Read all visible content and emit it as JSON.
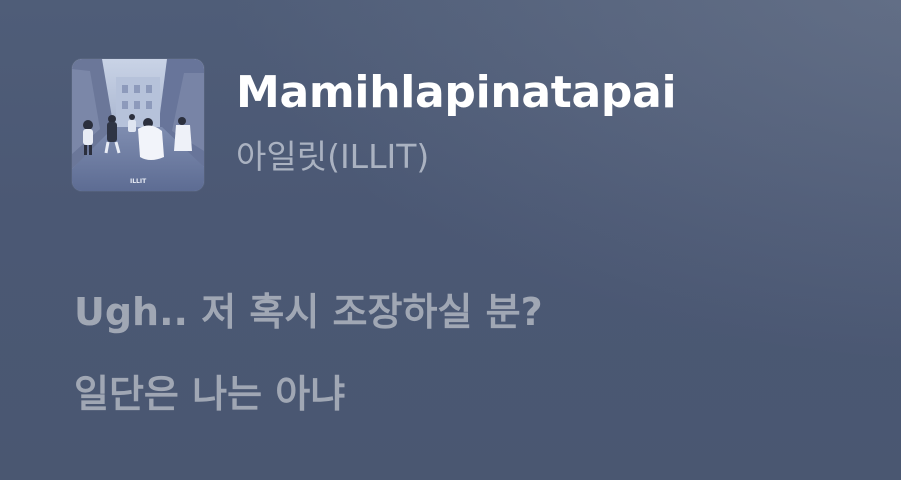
{
  "now_playing": {
    "title": "Mamihlapinatapai",
    "artist": "아일릿(ILLIT)",
    "cover_icon": "album-cover-image"
  },
  "lyrics": [
    "Ugh.. 저 혹시 조장하실 분?",
    "일단은 나는 아냐"
  ],
  "colors": {
    "background": "#4b5874",
    "title": "#ffffff",
    "artist": "#aab2c1",
    "lyric_upcoming": "#a0a7b4"
  }
}
